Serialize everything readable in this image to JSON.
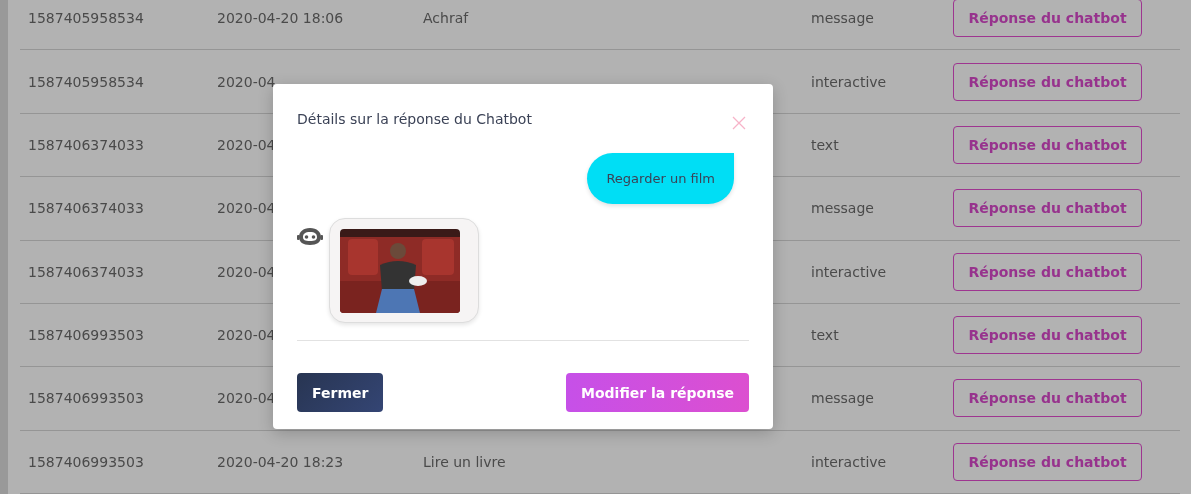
{
  "table": {
    "rows": [
      {
        "id": "1587405958534",
        "date": "2020-04-20 18:06",
        "text": "Achraf",
        "type": "message",
        "action": "Réponse du chatbot"
      },
      {
        "id": "1587405958534",
        "date": "2020-04",
        "type": "interactive",
        "action": "Réponse du chatbot"
      },
      {
        "id": "1587406374033",
        "date": "2020-04",
        "type": "text",
        "action": "Réponse du chatbot"
      },
      {
        "id": "1587406374033",
        "date": "2020-04",
        "type": "message",
        "action": "Réponse du chatbot"
      },
      {
        "id": "1587406374033",
        "date": "2020-04",
        "type": "interactive",
        "action": "Réponse du chatbot"
      },
      {
        "id": "1587406993503",
        "date": "2020-04",
        "type": "text",
        "action": "Réponse du chatbot"
      },
      {
        "id": "1587406993503",
        "date": "2020-04",
        "type": "message",
        "action": "Réponse du chatbot"
      },
      {
        "id": "1587406993503",
        "date": "2020-04-20 18:23",
        "text": "Lire un livre",
        "type": "interactive",
        "action": "Réponse du chatbot"
      }
    ]
  },
  "modal": {
    "title": "Détails sur la réponse du Chatbot",
    "messages": [
      {
        "kind": "user",
        "text": "Regarder un film"
      },
      {
        "kind": "picture"
      }
    ],
    "buttons": [
      {
        "kind": "secondary",
        "label": "Fermer"
      },
      {
        "kind": "primary",
        "label": "Modifier la réponse"
      }
    ]
  }
}
